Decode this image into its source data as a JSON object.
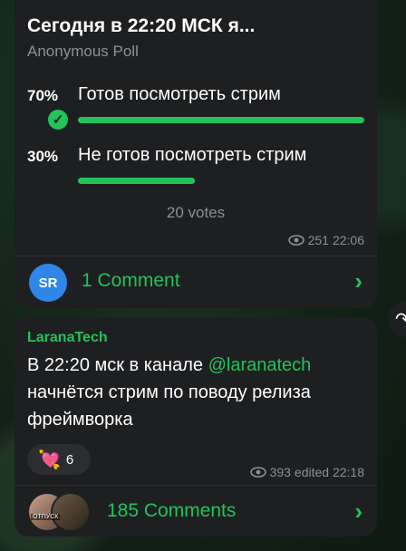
{
  "poll": {
    "title": "Сегодня в 22:20 МСК я...",
    "type": "Anonymous Poll",
    "options": [
      {
        "percent": "70%",
        "text": "Готов посмотреть стрим",
        "share": 0.7,
        "chosen": true
      },
      {
        "percent": "30%",
        "text": "Не готов посмотреть стрим",
        "share": 0.3,
        "chosen": false
      }
    ],
    "votes": "20 votes",
    "views": "251",
    "time": "22:06",
    "comments": {
      "avatar_initials": "SR",
      "label": "1 Comment"
    }
  },
  "post": {
    "author": "LaranaTech",
    "text_before": "В 22:20 мск в канале ",
    "mention": "@laranatech",
    "text_after": " начнётся стрим по поводу релиза фреймворка",
    "reaction": {
      "emoji": "heart-with-arrow-icon",
      "count": "6"
    },
    "views": "393",
    "edited": "edited 22:18",
    "comments": {
      "avatar_tag": "ОТПУСК",
      "label": "185 Comments"
    }
  },
  "colors": {
    "accent": "#22c35a",
    "bubble": "#1e1f21",
    "muted": "#8d8f92",
    "avatar_blue": "#2f86e8"
  }
}
